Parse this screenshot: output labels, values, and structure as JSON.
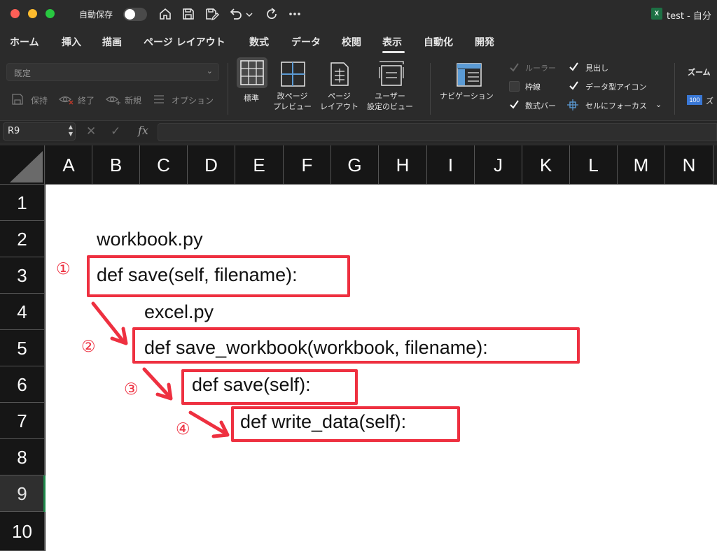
{
  "titlebar": {
    "autosave_label": "自動保存",
    "document_title": "test - 自分",
    "app_badge": "X"
  },
  "ribbon_tabs": [
    "ホーム",
    "挿入",
    "描画",
    "ページ レイアウト",
    "数式",
    "データ",
    "校閲",
    "表示",
    "自動化",
    "開発"
  ],
  "active_tab": "表示",
  "sheet_view": {
    "style_value": "既定",
    "keep": "保持",
    "exit": "終了",
    "new": "新規",
    "options": "オプション"
  },
  "workbook_views": {
    "normal": "標準",
    "page_break_1": "改ページ",
    "page_break_2": "プレビュー",
    "page_layout_1": "ページ",
    "page_layout_2": "レイアウト",
    "custom_1": "ユーザー",
    "custom_2": "設定のビュー"
  },
  "navigation": "ナビゲーション",
  "show": {
    "ruler": "ルーラー",
    "gridlines": "枠線",
    "formula_bar": "数式バー",
    "headings": "見出し",
    "data_type_icons": "データ型アイコン",
    "focus_cell": "セルにフォーカス"
  },
  "zoom": {
    "group_label": "ズーム",
    "badge": "100",
    "button": "ズ"
  },
  "formula_bar": {
    "name_box": "R9",
    "fx": "fx",
    "content": ""
  },
  "grid": {
    "columns": [
      "A",
      "B",
      "C",
      "D",
      "E",
      "F",
      "G",
      "H",
      "I",
      "J",
      "K",
      "L",
      "M",
      "N"
    ],
    "rows": [
      "1",
      "2",
      "3",
      "4",
      "5",
      "6",
      "7",
      "8",
      "9",
      "10"
    ],
    "selected_row": "9"
  },
  "cells": {
    "workbook_py": "workbook.py",
    "def_save": "def save(self, filename):",
    "excel_py": "excel.py",
    "def_save_workbook": "def save_workbook(workbook, filename):",
    "def_save_self": "def save(self):",
    "def_write_data": "def write_data(self):"
  },
  "markers": [
    "①",
    "②",
    "③",
    "④"
  ],
  "colors": {
    "annotation_red": "#ee3040",
    "excel_green": "#1d7044",
    "selection_green": "#1f8a4c"
  }
}
